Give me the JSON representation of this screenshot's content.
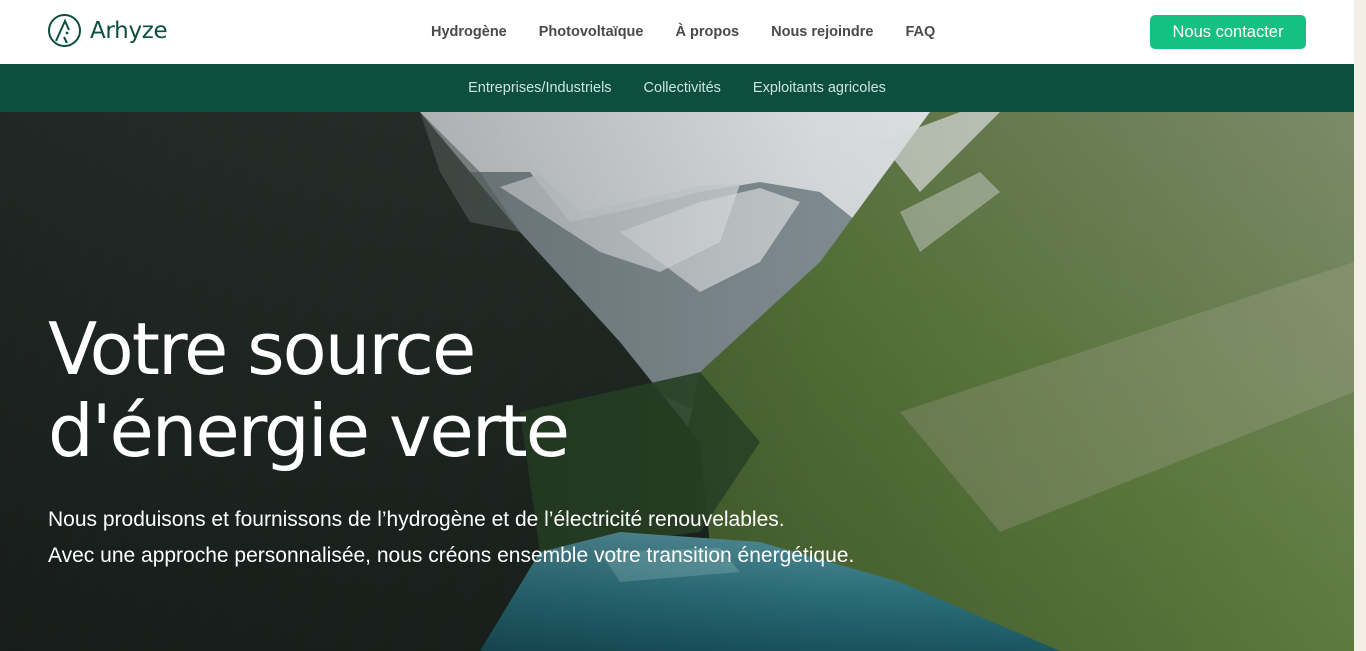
{
  "brand": {
    "name": "Arhyze",
    "logo_icon": "arhyze-logo-icon"
  },
  "main_nav": [
    {
      "label": "Hydrogène"
    },
    {
      "label": "Photovoltaïque"
    },
    {
      "label": "À propos"
    },
    {
      "label": "Nous rejoindre"
    },
    {
      "label": "FAQ"
    }
  ],
  "cta": {
    "label": "Nous contacter"
  },
  "sub_nav": [
    {
      "label": "Entreprises/Industriels"
    },
    {
      "label": "Collectivités"
    },
    {
      "label": "Exploitants agricoles"
    }
  ],
  "hero": {
    "title_line1": "Votre source",
    "title_line2": "d'énergie verte",
    "subtitle_line1": "Nous produisons et fournissons de l’hydrogène et de l’électricité renouvelables.",
    "subtitle_line2": "Avec une approche personnalisée, nous créons ensemble votre transition énergétique.",
    "image": "mountain-lake-valley-photo"
  },
  "colors": {
    "brand_green": "#0d4f3e",
    "cta_green": "#15c083",
    "subnav_bg": "#0c4f3f"
  }
}
